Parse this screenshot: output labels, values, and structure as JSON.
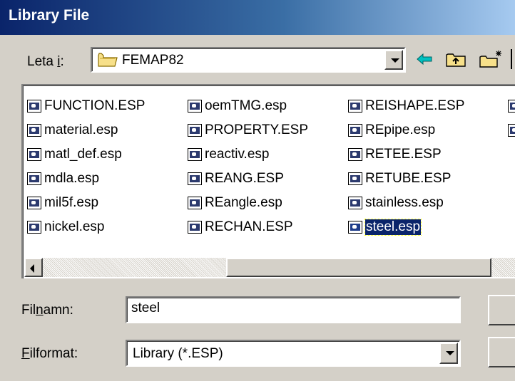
{
  "window": {
    "title": "Library File"
  },
  "look_in": {
    "label_pre": "Leta ",
    "label_key": "i",
    "label_post": ":",
    "value": "FEMAP82",
    "folder_icon": "folder-icon"
  },
  "toolbar": {
    "back_icon": "back-arrow-icon",
    "up_icon": "up-folder-icon",
    "new_folder_icon": "new-folder-icon"
  },
  "files": {
    "columns": [
      [
        "FUNCTION.ESP",
        "material.esp",
        "matl_def.esp",
        "mdla.esp",
        "mil5f.esp",
        "nickel.esp"
      ],
      [
        "oemTMG.esp",
        "PROPERTY.ESP",
        "reactiv.esp",
        "REANG.ESP",
        "REangle.esp",
        "RECHAN.ESP"
      ],
      [
        "REISHAPE.ESP",
        "REpipe.esp",
        "RETEE.ESP",
        "RETUBE.ESP",
        "stainless.esp",
        "steel.esp"
      ]
    ],
    "selected": "steel.esp"
  },
  "filename": {
    "label_pre": "Fil",
    "label_key": "n",
    "label_post": "amn:",
    "value": "steel"
  },
  "filetype": {
    "label_pre": "",
    "label_key": "F",
    "label_post": "ilformat:",
    "value": "Library (*.ESP)"
  },
  "colors": {
    "title_start": "#0a246a",
    "title_end": "#a6caf0",
    "selection": "#0a246a",
    "face": "#d4d0c8"
  }
}
